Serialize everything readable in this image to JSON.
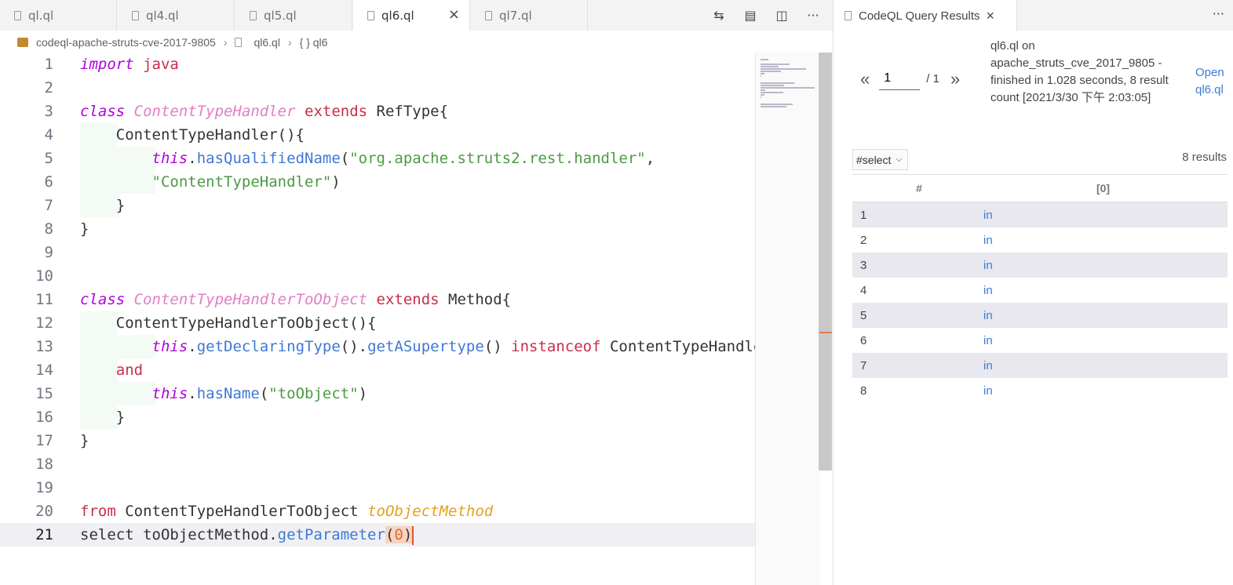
{
  "editor": {
    "tabs": [
      {
        "label": "ql.ql",
        "active": false
      },
      {
        "label": "ql4.ql",
        "active": false
      },
      {
        "label": "ql5.ql",
        "active": false
      },
      {
        "label": "ql6.ql",
        "active": true
      },
      {
        "label": "ql7.ql",
        "active": false
      }
    ],
    "tab_close_glyph": "×",
    "actions": {
      "compare": "⇆",
      "preview": "▤",
      "split": "◫",
      "more": "···"
    },
    "breadcrumb": {
      "folder": "codeql-apache-struts-cve-2017-9805",
      "file": "ql6.ql",
      "symbol": "{ } ql6"
    },
    "current_line": 21,
    "lines": [
      {
        "n": "1",
        "segs": [
          [
            "kw-i",
            "import"
          ],
          [
            "plain",
            " "
          ],
          [
            "kw-r",
            "java"
          ]
        ]
      },
      {
        "n": "2",
        "segs": []
      },
      {
        "n": "3",
        "segs": [
          [
            "kw-i",
            "class"
          ],
          [
            "plain",
            " "
          ],
          [
            "cls-i",
            "ContentTypeHandler"
          ],
          [
            "plain",
            " "
          ],
          [
            "kw-r",
            "extends"
          ],
          [
            "plain",
            " RefType{"
          ]
        ]
      },
      {
        "n": "4",
        "segs": [
          [
            "plain",
            "    ContentTypeHandler(){"
          ]
        ]
      },
      {
        "n": "5",
        "segs": [
          [
            "plain",
            "        "
          ],
          [
            "kw-i",
            "this"
          ],
          [
            "plain",
            "."
          ],
          [
            "fn",
            "hasQualifiedName"
          ],
          [
            "plain",
            "("
          ],
          [
            "str",
            "\"org.apache.struts2.rest.handler\""
          ],
          [
            "plain",
            ","
          ]
        ]
      },
      {
        "n": "6",
        "segs": [
          [
            "plain",
            "        "
          ],
          [
            "str",
            "\"ContentTypeHandler\""
          ],
          [
            "plain",
            ")"
          ]
        ]
      },
      {
        "n": "7",
        "segs": [
          [
            "plain",
            "    }"
          ]
        ]
      },
      {
        "n": "8",
        "segs": [
          [
            "plain",
            "}"
          ]
        ]
      },
      {
        "n": "9",
        "segs": []
      },
      {
        "n": "10",
        "segs": []
      },
      {
        "n": "11",
        "segs": [
          [
            "kw-i",
            "class"
          ],
          [
            "plain",
            " "
          ],
          [
            "cls-i",
            "ContentTypeHandlerToObject"
          ],
          [
            "plain",
            " "
          ],
          [
            "kw-r",
            "extends"
          ],
          [
            "plain",
            " Method{"
          ]
        ]
      },
      {
        "n": "12",
        "segs": [
          [
            "plain",
            "    ContentTypeHandlerToObject(){"
          ]
        ]
      },
      {
        "n": "13",
        "segs": [
          [
            "plain",
            "        "
          ],
          [
            "kw-i",
            "this"
          ],
          [
            "plain",
            "."
          ],
          [
            "fn",
            "getDeclaringType"
          ],
          [
            "plain",
            "()."
          ],
          [
            "fn",
            "getASupertype"
          ],
          [
            "plain",
            "() "
          ],
          [
            "kw-r",
            "instanceof"
          ],
          [
            "plain",
            " ContentTypeHandler"
          ]
        ]
      },
      {
        "n": "14",
        "segs": [
          [
            "plain",
            "    "
          ],
          [
            "kw-r",
            "and"
          ]
        ]
      },
      {
        "n": "15",
        "segs": [
          [
            "plain",
            "        "
          ],
          [
            "kw-i",
            "this"
          ],
          [
            "plain",
            "."
          ],
          [
            "fn",
            "hasName"
          ],
          [
            "plain",
            "("
          ],
          [
            "str",
            "\"toObject\""
          ],
          [
            "plain",
            ")"
          ]
        ]
      },
      {
        "n": "16",
        "segs": [
          [
            "plain",
            "    }"
          ]
        ]
      },
      {
        "n": "17",
        "segs": [
          [
            "plain",
            "}"
          ]
        ]
      },
      {
        "n": "18",
        "segs": []
      },
      {
        "n": "19",
        "segs": []
      },
      {
        "n": "20",
        "segs": [
          [
            "kw-r",
            "from"
          ],
          [
            "plain",
            " ContentTypeHandlerToObject "
          ],
          [
            "var-i",
            "toObjectMethod"
          ]
        ]
      },
      {
        "n": "21",
        "segs": [
          [
            "plain",
            "select toObjectMethod."
          ],
          [
            "fn",
            "getParameter"
          ],
          [
            "bracket-hl",
            "("
          ],
          [
            "num",
            "0"
          ],
          [
            "bracket-hl",
            ")"
          ]
        ]
      }
    ]
  },
  "results": {
    "tab_title": "CodeQL Query Results",
    "tab_close_glyph": "×",
    "more_glyph": "···",
    "pager": {
      "prev": "«",
      "page": "1",
      "total": "/ 1",
      "next": "»"
    },
    "query_info": "ql6.ql on apache_struts_cve_2017_9805 - finished in 1.028 seconds, 8 result count [2021/3/30 下午 2:03:05]",
    "open_link": "Open ql6.ql",
    "select_label": "#select",
    "result_count": "8 results",
    "columns": [
      "#",
      "[0]"
    ],
    "rows": [
      {
        "num": "1",
        "val": "in"
      },
      {
        "num": "2",
        "val": "in"
      },
      {
        "num": "3",
        "val": "in"
      },
      {
        "num": "4",
        "val": "in"
      },
      {
        "num": "5",
        "val": "in"
      },
      {
        "num": "6",
        "val": "in"
      },
      {
        "num": "7",
        "val": "in"
      },
      {
        "num": "8",
        "val": "in"
      }
    ]
  }
}
